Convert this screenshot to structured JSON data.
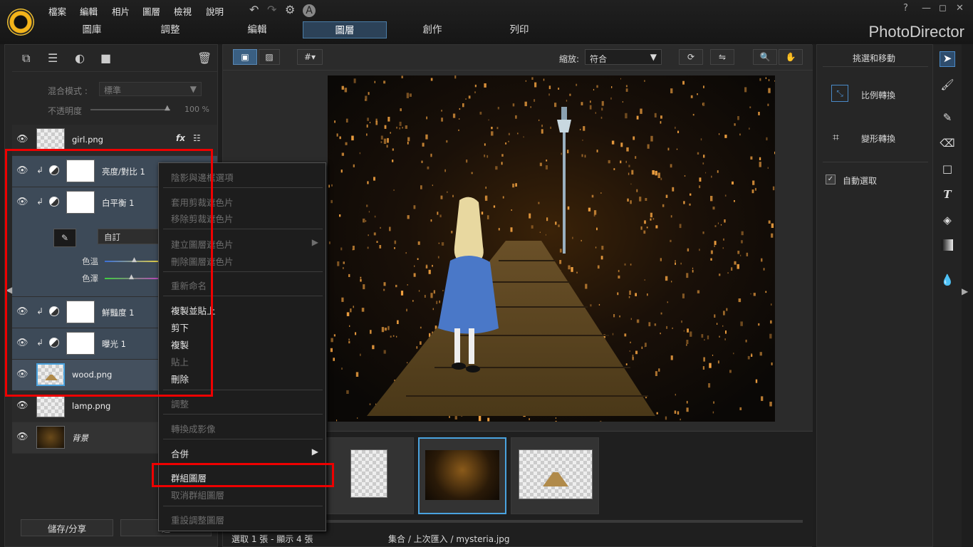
{
  "menu": [
    "檔案",
    "編輯",
    "相片",
    "圖層",
    "檢視",
    "說明"
  ],
  "nav_tabs": [
    "圖庫",
    "調整",
    "編輯",
    "圖層",
    "創作",
    "列印"
  ],
  "brand": "PhotoDirector",
  "window_controls": [
    "?",
    "—",
    "◻",
    "✕"
  ],
  "left": {
    "blend_label": "混合模式 :",
    "blend_value": "標準",
    "opacity_label": "不透明度",
    "opacity_value": "100 %",
    "layers": [
      "girl.png",
      "亮度/對比 1",
      "白平衡 1",
      "鮮豔度 1",
      "曝光 1",
      "wood.png",
      "lamp.png",
      "背景"
    ],
    "wb_preset": "自訂",
    "temp_label": "色溫",
    "tint_label": "色澤",
    "save_share": "儲存/分享",
    "bottom_btn2": "返"
  },
  "context_menu": {
    "items": [
      "陰影與邊框選項",
      "套用剪裁遮色片",
      "移除剪裁遮色片",
      "建立圖層遮色片",
      "刪除圖層遮色片",
      "重新命名",
      "複製並貼上",
      "剪下",
      "複製",
      "貼上",
      "刪除",
      "調整",
      "轉換成影像",
      "合併",
      "群組圖層",
      "取消群組圖層",
      "重設調整圖層"
    ]
  },
  "center": {
    "zoom_label": "縮放:",
    "zoom_value": "符合",
    "status_left": "選取 1 張 - 顯示 4 張",
    "status_path": "集合 / 上次匯入 / mysteria.jpg"
  },
  "right": {
    "title": "挑選和移動",
    "scale": "比例轉換",
    "transform": "變形轉換",
    "auto_select": "自動選取"
  },
  "icons": [
    "undo-icon",
    "redo-icon",
    "gear-icon",
    "alert-icon",
    "eye-icon",
    "trash-icon",
    "brush-icon",
    "eraser-icon",
    "rect-icon",
    "text-icon",
    "fill-icon",
    "gradient-icon",
    "drop-icon",
    "hand-icon",
    "zoom-icon",
    "grid-icon"
  ],
  "colors": {
    "accent": "#4b7ea8",
    "highlight": "#e00000",
    "bg": "#1e1e1e"
  }
}
